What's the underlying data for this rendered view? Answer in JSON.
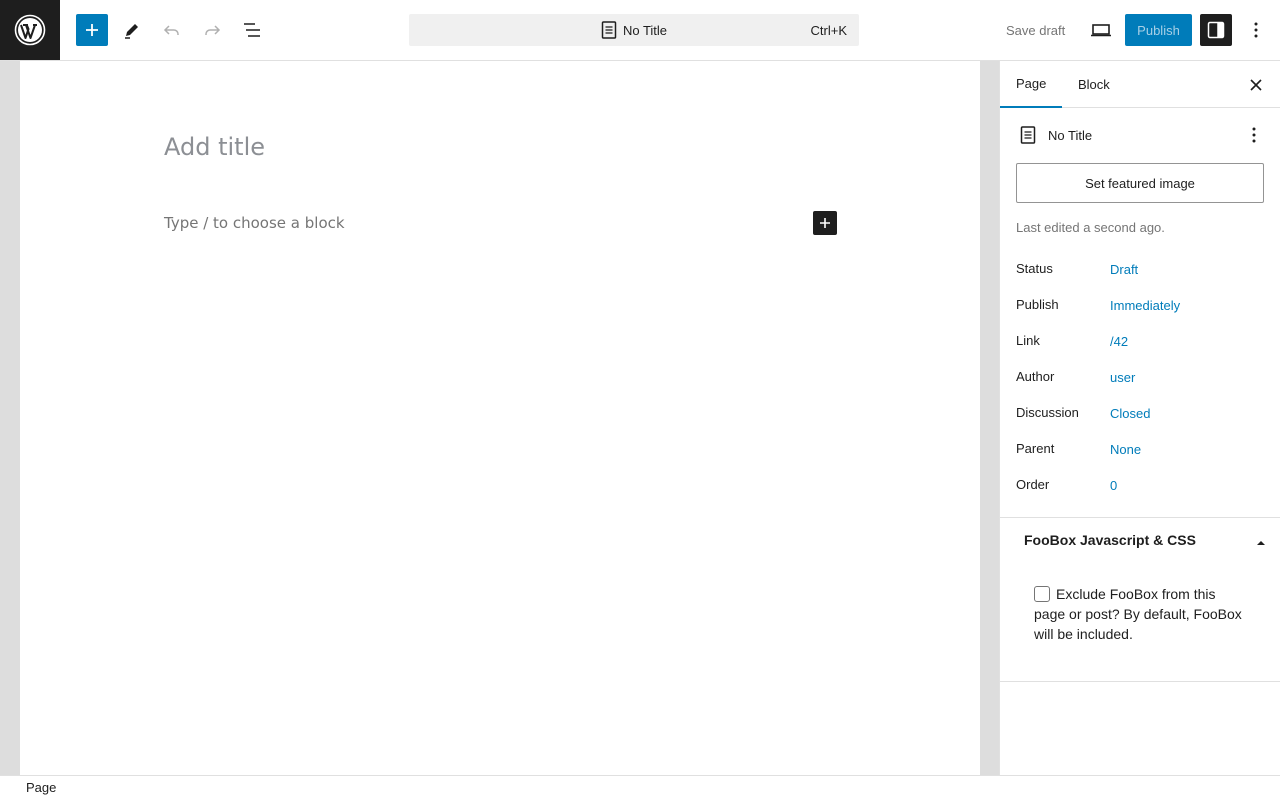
{
  "header": {
    "logo_icon": "wordpress-logo-icon",
    "inserter_icon": "plus-icon",
    "tools_icon": "pencil-icon",
    "undo_icon": "undo-icon",
    "redo_icon": "redo-icon",
    "list_view_icon": "list-view-icon",
    "command_bar": {
      "icon": "page-icon",
      "title": "No Title",
      "shortcut": "Ctrl+K"
    },
    "save_draft_label": "Save draft",
    "preview_icon": "desktop-preview-icon",
    "publish_label": "Publish",
    "settings_icon": "sidebar-toggle-icon",
    "options_icon": "more-vertical-icon"
  },
  "editor": {
    "title_placeholder": "Add title",
    "block_placeholder": "Type / to choose a block",
    "block_inserter_icon": "plus-icon"
  },
  "sidebar": {
    "tabs": [
      {
        "label": "Page",
        "active": true
      },
      {
        "label": "Block",
        "active": false
      }
    ],
    "close_icon": "close-icon",
    "summary": {
      "icon": "page-icon",
      "title": "No Title",
      "more_icon": "more-vertical-icon"
    },
    "featured_image_label": "Set featured image",
    "last_edited": "Last edited a second ago.",
    "meta": [
      {
        "label": "Status",
        "value": "Draft"
      },
      {
        "label": "Publish",
        "value": "Immediately"
      },
      {
        "label": "Link",
        "value": "/42"
      },
      {
        "label": "Author",
        "value": "user"
      },
      {
        "label": "Discussion",
        "value": "Closed"
      },
      {
        "label": "Parent",
        "value": "None"
      },
      {
        "label": "Order",
        "value": "0"
      }
    ],
    "foobox": {
      "title": "FooBox Javascript & CSS",
      "expanded": true,
      "checkbox_label": "Exclude FooBox from this page or post? By default, FooBox will be included.",
      "checked": false
    }
  },
  "footer": {
    "breadcrumb": "Page"
  },
  "colors": {
    "accent": "#007cba",
    "dark": "#1e1e1e",
    "muted": "#757575"
  }
}
